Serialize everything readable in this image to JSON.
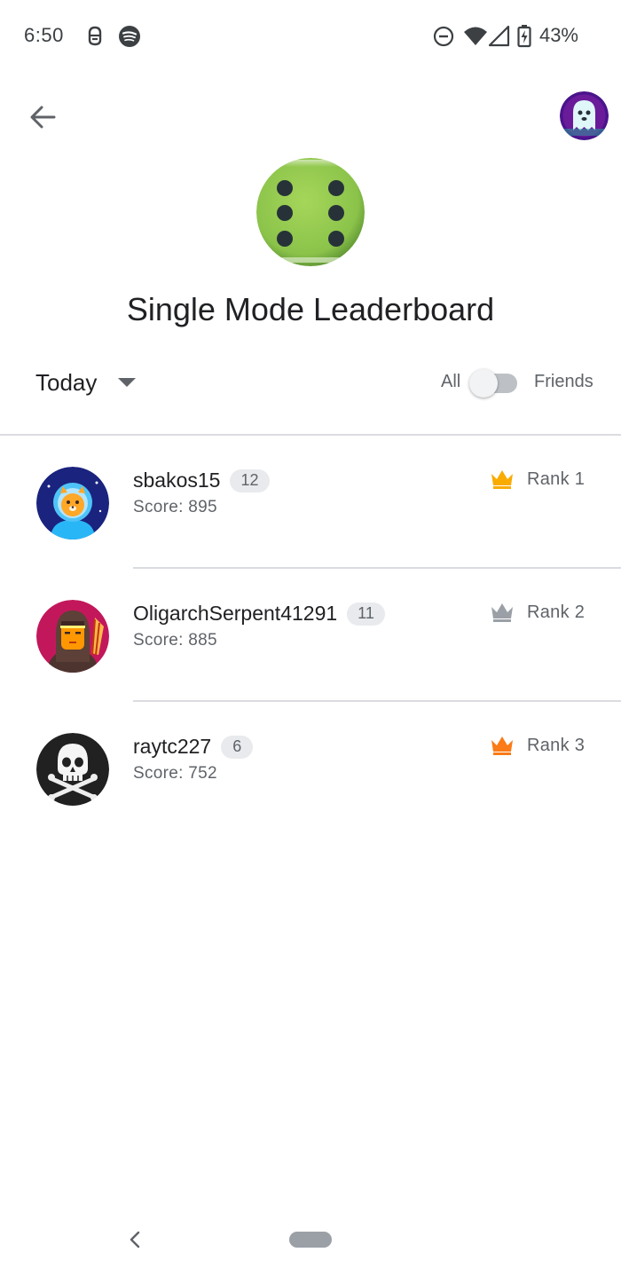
{
  "status_bar": {
    "time": "6:50",
    "battery": "43%",
    "icons": [
      "notification-icon",
      "spotify-icon",
      "do-not-disturb-icon",
      "wifi-icon",
      "cell-signal-icon",
      "battery-charging-icon"
    ]
  },
  "header": {
    "back_icon": "arrow-back-icon",
    "profile_avatar": "ghost-avatar",
    "game_icon": "green-dice-icon",
    "title": "Single Mode Leaderboard"
  },
  "filters": {
    "time_range": "Today",
    "scope_left": "All",
    "scope_right": "Friends",
    "friends_only": false
  },
  "leaderboard": {
    "rows": [
      {
        "name": "sbakos15",
        "level": "12",
        "score": "Score: 895",
        "rank": "Rank 1",
        "crown_color": "#f9ab00",
        "avatar": "astronaut-cat-avatar"
      },
      {
        "name": "OligarchSerpent41291",
        "level": "11",
        "score": "Score: 885",
        "rank": "Rank 2",
        "crown_color": "#9aa0a6",
        "avatar": "archer-avatar"
      },
      {
        "name": "raytc227",
        "level": "6",
        "score": "Score: 752",
        "rank": "Rank 3",
        "crown_color": "#fa7b17",
        "avatar": "skull-avatar"
      }
    ]
  },
  "colors": {
    "divider": "#dadce0",
    "text_primary": "#202124",
    "text_secondary": "#5f6368",
    "dice_green": "#8bc34a"
  },
  "nav_bar": {
    "back_icon": "nav-back-icon",
    "home_icon": "nav-home-pill"
  }
}
